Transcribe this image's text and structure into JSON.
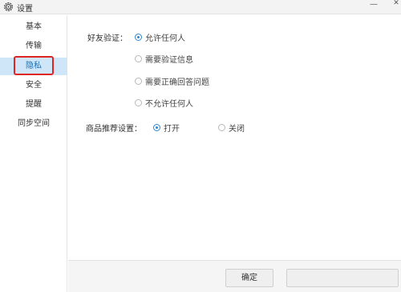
{
  "window": {
    "title": "设置",
    "minimize_symbol": "—",
    "close_symbol": "✕"
  },
  "sidebar": {
    "items": [
      {
        "label": "基本"
      },
      {
        "label": "传输"
      },
      {
        "label": "隐私",
        "selected": true
      },
      {
        "label": "安全"
      },
      {
        "label": "提醒"
      },
      {
        "label": "同步空间"
      }
    ]
  },
  "privacy": {
    "friend_verification": {
      "label": "好友验证：",
      "options": [
        {
          "label": "允许任何人",
          "checked": true
        },
        {
          "label": "需要验证信息",
          "checked": false
        },
        {
          "label": "需要正确回答问题",
          "checked": false
        },
        {
          "label": "不允许任何人",
          "checked": false
        }
      ]
    },
    "recommend": {
      "label": "商品推荐设置：",
      "options": [
        {
          "label": "打开",
          "checked": true
        },
        {
          "label": "关闭",
          "checked": false
        }
      ]
    }
  },
  "footer": {
    "ok_label": "确定",
    "second_label": ""
  },
  "colors": {
    "accent": "#2b8ad6",
    "selected_bg": "#cfe6f8",
    "highlight": "#e02424"
  }
}
